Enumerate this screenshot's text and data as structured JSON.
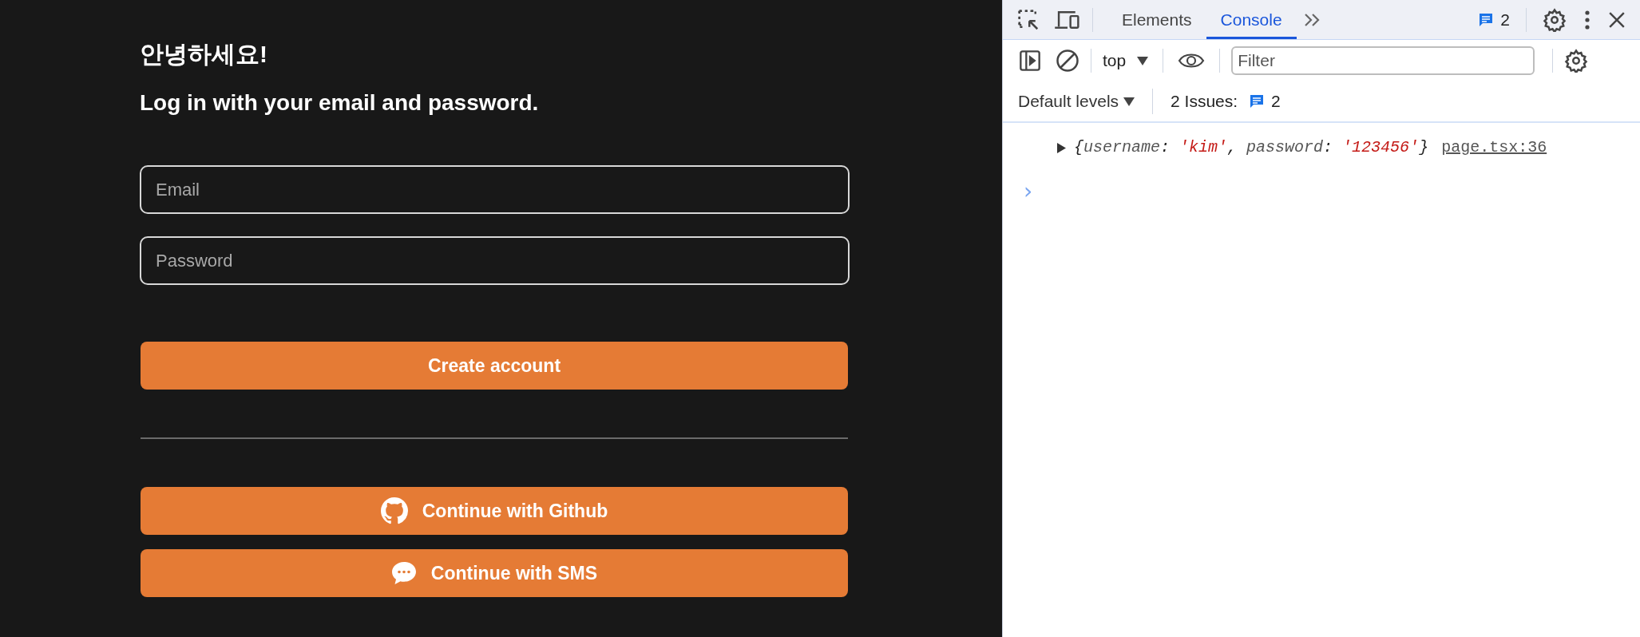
{
  "login": {
    "greeting": "안녕하세요!",
    "subtitle": "Log in with your email and password.",
    "fields": [
      {
        "placeholder": "Email"
      },
      {
        "placeholder": "Password"
      }
    ],
    "submit": "Create account",
    "social": [
      {
        "label": "Continue with Github",
        "kind": "github"
      },
      {
        "label": "Continue with SMS",
        "kind": "sms"
      }
    ]
  },
  "devtools": {
    "tabs": [
      {
        "label": "Elements",
        "selected": false
      },
      {
        "label": "Console",
        "selected": true
      }
    ],
    "issues_badge": "2",
    "context": "top",
    "filter": {
      "placeholder": "Filter"
    },
    "levels": "Default levels",
    "issues_label": "2 Issues:",
    "issues_count": "2",
    "messages": [
      {
        "parts": [
          {
            "text": "{",
            "kind": "punct"
          },
          {
            "text": "username",
            "kind": "key"
          },
          {
            "text": ": ",
            "kind": "punct"
          },
          {
            "text": "'kim'",
            "kind": "string"
          },
          {
            "text": ", ",
            "kind": "punct"
          },
          {
            "text": "password",
            "kind": "key"
          },
          {
            "text": ": ",
            "kind": "punct"
          },
          {
            "text": "'123456'",
            "kind": "string"
          },
          {
            "text": "}",
            "kind": "punct"
          }
        ],
        "source": "page.tsx:36"
      }
    ],
    "prompt": "›"
  }
}
